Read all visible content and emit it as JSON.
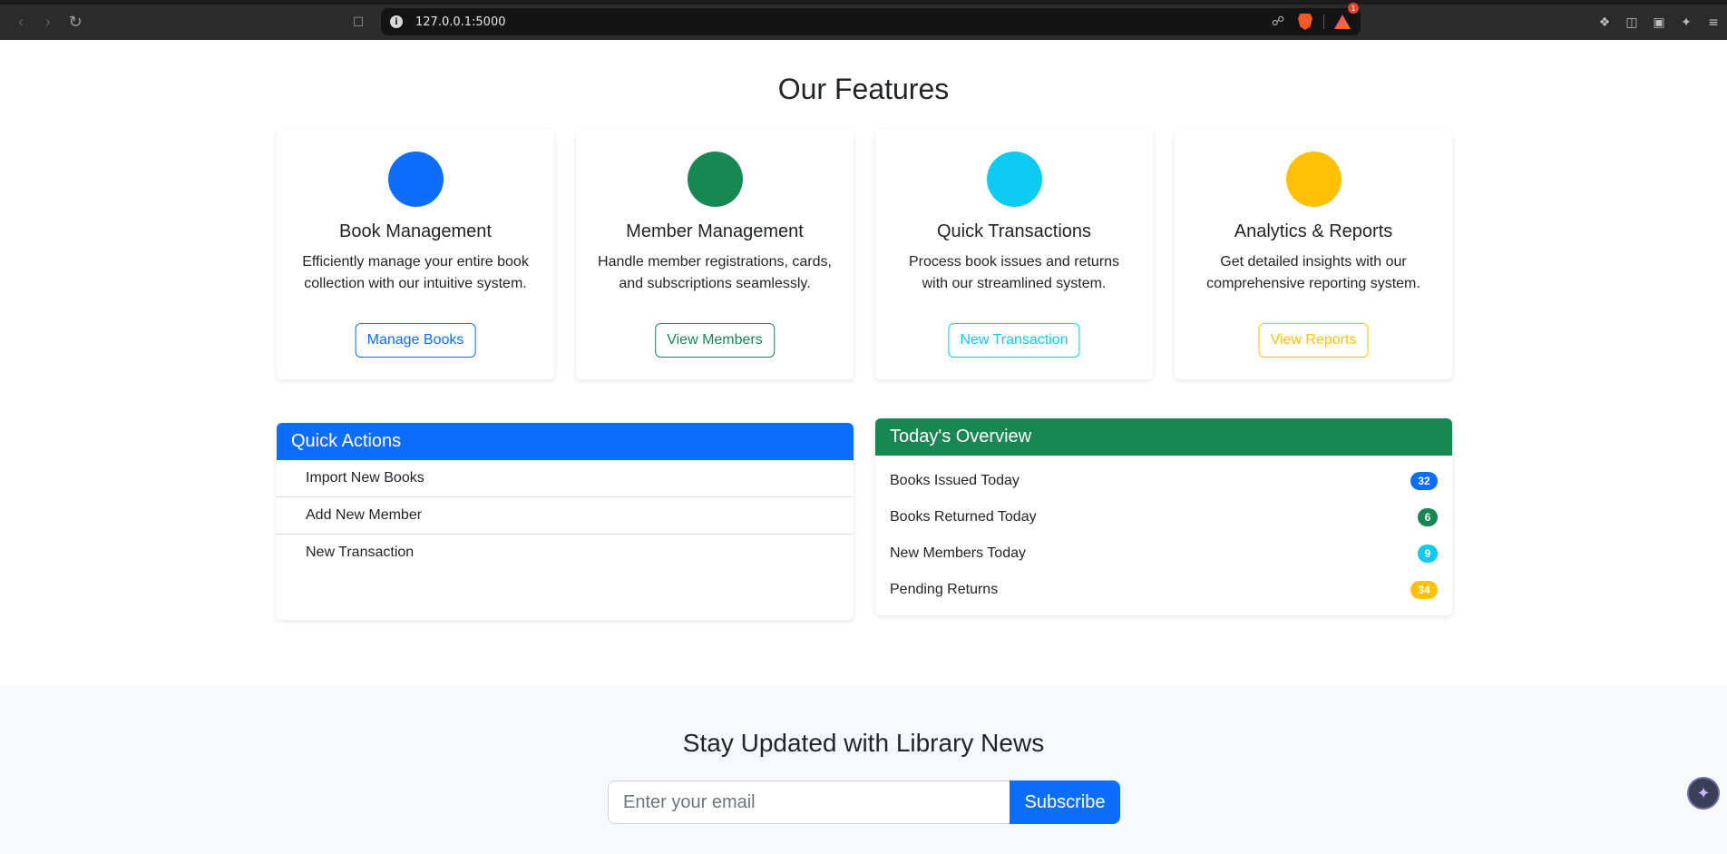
{
  "browser": {
    "url": "127.0.0.1:5000",
    "notification_count": "1"
  },
  "features": {
    "title": "Our Features",
    "cards": [
      {
        "title": "Book Management",
        "description": "Efficiently manage your entire book collection with our intuitive system.",
        "button": "Manage Books",
        "color": "#0d6efd"
      },
      {
        "title": "Member Management",
        "description": "Handle member registrations, cards, and subscriptions seamlessly.",
        "button": "View Members",
        "color": "#198754"
      },
      {
        "title": "Quick Transactions",
        "description": "Process book issues and returns with our streamlined system.",
        "button": "New Transaction",
        "color": "#0dcaf0"
      },
      {
        "title": "Analytics & Reports",
        "description": "Get detailed insights with our comprehensive reporting system.",
        "button": "View Reports",
        "color": "#ffc107"
      }
    ]
  },
  "quick_actions": {
    "title": "Quick Actions",
    "color": "#0d6efd",
    "items": [
      "Import New Books",
      "Add New Member",
      "New Transaction"
    ]
  },
  "overview": {
    "title": "Today's Overview",
    "color": "#198754",
    "items": [
      {
        "label": "Books Issued Today",
        "value": "32",
        "color": "#0d6efd"
      },
      {
        "label": "Books Returned Today",
        "value": "6",
        "color": "#198754"
      },
      {
        "label": "New Members Today",
        "value": "9",
        "color": "#0dcaf0"
      },
      {
        "label": "Pending Returns",
        "value": "34",
        "color": "#ffc107"
      }
    ]
  },
  "newsletter": {
    "title": "Stay Updated with Library News",
    "email_placeholder": "Enter your email",
    "subscribe_label": "Subscribe"
  }
}
